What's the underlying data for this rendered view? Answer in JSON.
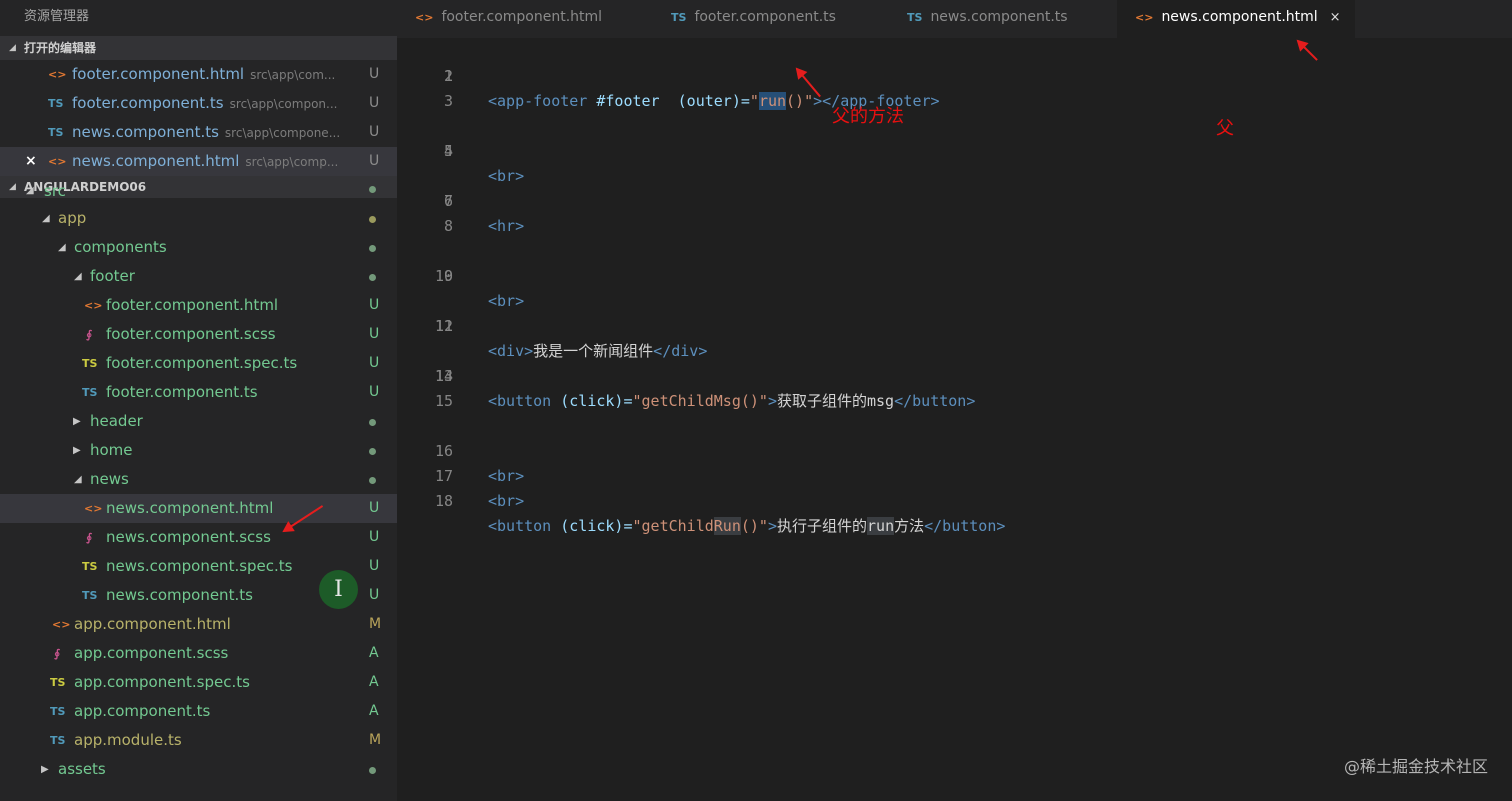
{
  "sidebar": {
    "title": "资源管理器",
    "open_editors_header": "打开的编辑器",
    "open_editors": [
      {
        "icon": "<>",
        "name": "footer.component.html",
        "path": "src\\app\\com...",
        "status": "U"
      },
      {
        "icon": "TS",
        "name": "footer.component.ts",
        "path": "src\\app\\compon...",
        "status": "U"
      },
      {
        "icon": "TS",
        "name": "news.component.ts",
        "path": "src\\app\\compone...",
        "status": "U"
      },
      {
        "close": "×",
        "icon": "<>",
        "name": "news.component.html",
        "path": "src\\app\\comp...",
        "status": "U"
      }
    ],
    "project_header": "ANGULARDEMO06",
    "tree": {
      "src": "src",
      "app": "app",
      "components": "components",
      "footer": "footer",
      "footer_html": "footer.component.html",
      "footer_scss": "footer.component.scss",
      "footer_spec": "footer.component.spec.ts",
      "footer_ts": "footer.component.ts",
      "header": "header",
      "home": "home",
      "news": "news",
      "news_html": "news.component.html",
      "news_scss": "news.component.scss",
      "news_spec": "news.component.spec.ts",
      "news_ts": "news.component.ts",
      "app_html": "app.component.html",
      "app_scss": "app.component.scss",
      "app_spec": "app.component.spec.ts",
      "app_ts": "app.component.ts",
      "app_module": "app.module.ts",
      "assets": "assets"
    },
    "status": {
      "U": "U",
      "M": "M",
      "A": "A"
    },
    "icons": {
      "html": "<>",
      "ts": "TS",
      "scss": "∮"
    }
  },
  "tabs": [
    {
      "icon": "<>",
      "label": "footer.component.html"
    },
    {
      "icon": "TS",
      "label": "footer.component.ts"
    },
    {
      "icon": "TS",
      "label": "news.component.ts"
    },
    {
      "icon": "<>",
      "label": "news.component.html",
      "close": "×",
      "active": true
    }
  ],
  "editor": {
    "line_numbers": [
      "1",
      "2",
      "3",
      "4",
      "5",
      "6",
      "7",
      "8",
      "9",
      "10",
      "11",
      "12",
      "13",
      "14",
      "15",
      "16",
      "17",
      "18"
    ],
    "code": {
      "l1": {
        "open": "<app-footer",
        "ref": " #footer",
        "attr": "  (outer)=",
        "q1": "\"",
        "val": "run",
        "val2": "()",
        "q2": "\"",
        "close": "></app-footer>"
      },
      "l4": "<br>",
      "l6": "<hr>",
      "l9": "<br>",
      "l11": {
        "open": "<div>",
        "text": "我是一个新闻组件",
        "close": "</div>"
      },
      "l13": {
        "open": "<button",
        "attr": " (click)=",
        "val": "\"getChildMsg()\"",
        "gt": ">",
        "text": "获取子组件的msg",
        "close": "</button>"
      },
      "l16": "<br>",
      "l17": "<br>",
      "l18": {
        "open": "<button",
        "attr": " (click)=",
        "val_a": "\"getChild",
        "val_b": "Run",
        "val_c": "()\"",
        "gt": ">",
        "text_a": "执行子组件的",
        "text_b": "run",
        "text_c": "方法",
        "close": "</button>"
      }
    }
  },
  "annotations": {
    "parent_method": "父的方法",
    "parent": "父"
  },
  "cursor_glyph": "I",
  "watermark": "@稀土掘金技术社区",
  "colors": {
    "sidebar_bg": "#252526",
    "editor_bg": "#1f1f1f",
    "annotation_red": "#e81010",
    "selection": "#264f78"
  }
}
